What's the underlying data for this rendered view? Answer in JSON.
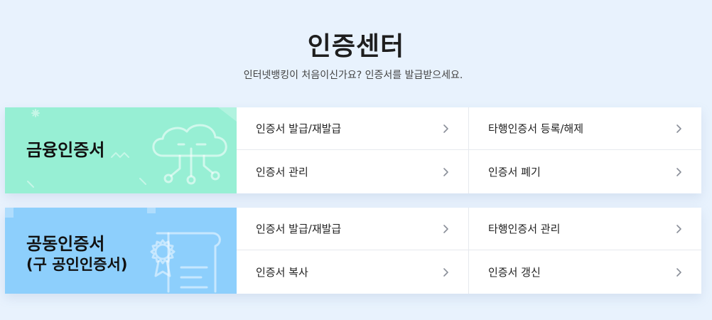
{
  "header": {
    "title": "인증센터",
    "subtitle": "인터넷뱅킹이 처음이신가요? 인증서를 발급받으세요."
  },
  "colors": {
    "page_background": "#e8f2fd",
    "financial_banner": "#97efd4",
    "joint_banner": "#8dcffc",
    "menu_background": "#ffffff"
  },
  "sections": {
    "financial": {
      "title": "금융인증서",
      "icon": "cloud-network-icon",
      "links": [
        {
          "label": "인증서 발급/재발급",
          "icon": "chevron-right-icon"
        },
        {
          "label": "타행인증서 등록/해제",
          "icon": "chevron-right-icon"
        },
        {
          "label": "인증서 관리",
          "icon": "chevron-right-icon"
        },
        {
          "label": "인증서 폐기",
          "icon": "chevron-right-icon"
        }
      ]
    },
    "joint": {
      "title": "공동인증서",
      "subtitle": "(구 공인인증서)",
      "icon": "certificate-scroll-icon",
      "links": [
        {
          "label": "인증서 발급/재발급",
          "icon": "chevron-right-icon"
        },
        {
          "label": "타행인증서 관리",
          "icon": "chevron-right-icon"
        },
        {
          "label": "인증서 복사",
          "icon": "chevron-right-icon"
        },
        {
          "label": "인증서 갱신",
          "icon": "chevron-right-icon"
        }
      ]
    }
  }
}
